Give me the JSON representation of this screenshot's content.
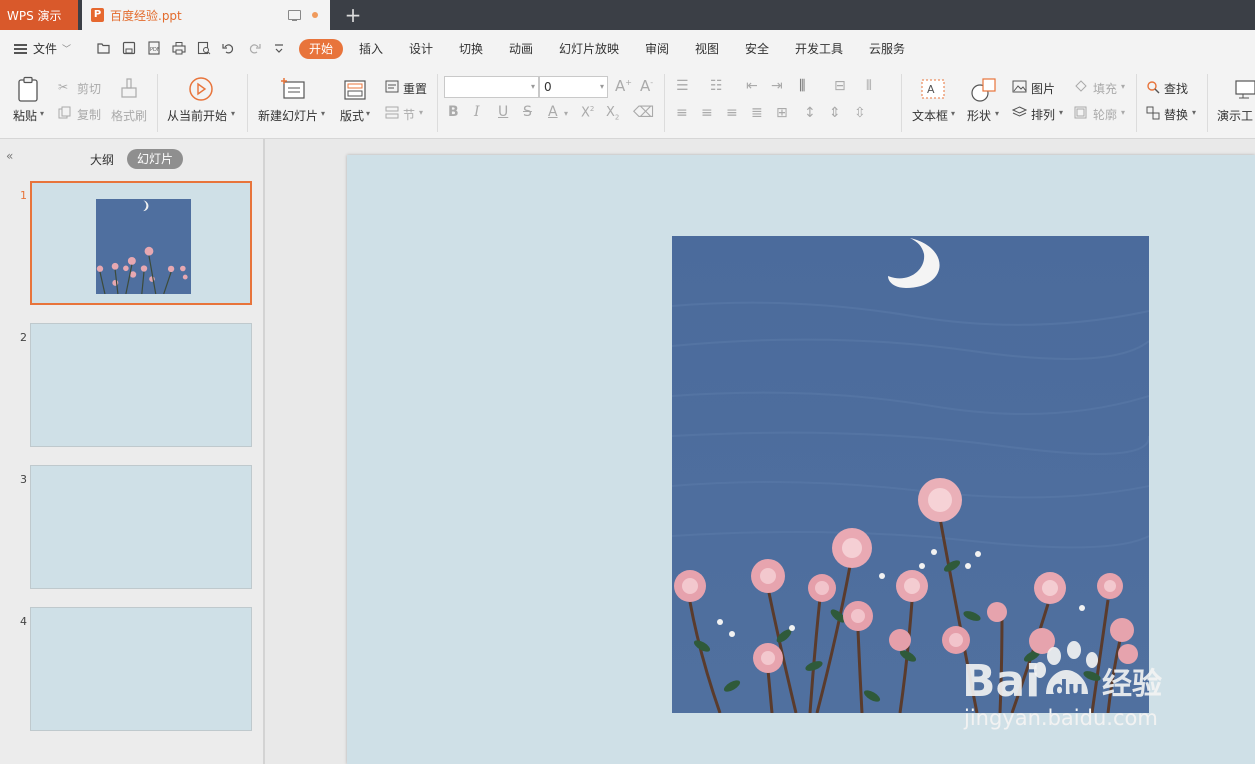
{
  "titlebar": {
    "app_tab": "WPS 演示",
    "doc_tab": "百度经验.ppt",
    "new_tab": "+"
  },
  "menubar": {
    "file": "文件",
    "tabs": [
      "开始",
      "插入",
      "设计",
      "切换",
      "动画",
      "幻灯片放映",
      "审阅",
      "视图",
      "安全",
      "开发工具",
      "云服务"
    ],
    "active_tab": "开始"
  },
  "ribbon": {
    "paste": "粘贴",
    "cut": "剪切",
    "copy": "复制",
    "format_painter": "格式刷",
    "play_from_current": "从当前开始",
    "new_slide": "新建幻灯片",
    "layout": "版式",
    "reset": "重置",
    "section": "节",
    "font_name": "",
    "font_size": "0",
    "text_box": "文本框",
    "shape": "形状",
    "picture": "图片",
    "arrange": "排列",
    "fill": "填充",
    "outline": "轮廓",
    "find": "查找",
    "replace": "替换",
    "presentation_tools": "演示工"
  },
  "left_pane": {
    "tab_outline": "大纲",
    "tab_slides": "幻灯片",
    "slides": [
      {
        "num": "1",
        "selected": true
      },
      {
        "num": "2",
        "selected": false
      },
      {
        "num": "3",
        "selected": false
      },
      {
        "num": "4",
        "selected": false
      }
    ]
  },
  "watermark": {
    "logo_text": "Bai du 经验",
    "url": "jingyan.baidu.com"
  },
  "colors": {
    "accent": "#e8743b",
    "slide_bg": "#cfe0e7",
    "painting_sky": "#4f6f9f"
  }
}
